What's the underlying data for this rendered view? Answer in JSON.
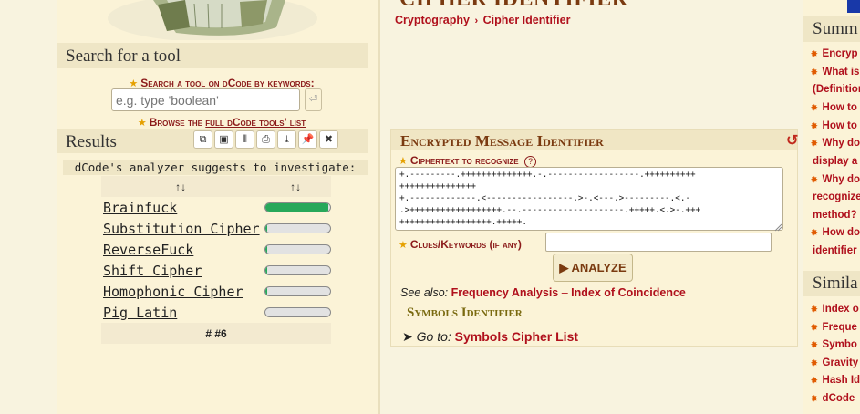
{
  "left": {
    "search_title": "Search for a tool",
    "search_label": "Search a tool on dCode by keywords:",
    "search_placeholder": "e.g. type 'boolean'",
    "browse_prefix": "Browse the ",
    "browse_link": "full dCode tools' list",
    "results_title": "Results",
    "analyzer_text": "dCode's analyzer suggests to investigate:",
    "sort_icon": "↑↓",
    "results": [
      {
        "name": "Brainfuck",
        "score": 0.97
      },
      {
        "name": "Substitution Cipher",
        "score": 0.03
      },
      {
        "name": "ReverseFuck",
        "score": 0.03
      },
      {
        "name": "Shift Cipher",
        "score": 0.03
      },
      {
        "name": "Homophonic Cipher",
        "score": 0.03
      },
      {
        "name": "Pig Latin",
        "score": 0.0
      }
    ],
    "footer": "# #6"
  },
  "header": {
    "page_title": "CIPHER IDENTIFIER",
    "breadcrumb_1": "Cryptography",
    "breadcrumb_sep": "›",
    "breadcrumb_2": "Cipher Identifier"
  },
  "panel": {
    "title": "Encrypted Message Identifier",
    "ciphertext_label": "Ciphertext to recognize",
    "ciphertext_value": "+.---------.++++++++++++++.-.------------------.++++++++++\n+++++++++++++++\n+.-------------.<-----------------.>-.<---.>---------.<.-\n.>++++++++++++++++++.--.--------------------.+++++.<.>-.+++\n++++++++++++++++++.+++++.",
    "clues_label": "Clues/Keywords (if any)",
    "clues_value": "",
    "analyze_label": "ANALYZE",
    "see_also_label": "See also:",
    "see_also_1": "Frequency Analysis",
    "see_also_sep": "–",
    "see_also_2": "Index of Coincidence",
    "symbols_title": "Symbols Identifier",
    "goto_label": "Go to:",
    "goto_link": "Symbols Cipher List"
  },
  "right": {
    "summary_title": "Summ",
    "summary_items": [
      "Encryp",
      "What is",
      "(Definition",
      "How to",
      "How to",
      "Why do",
      "display a",
      "Why do",
      "recognize",
      "method?",
      "How do",
      "identifier"
    ],
    "similar_title": "Simila",
    "similar_items": [
      "Index o",
      "Freque",
      "Symbo",
      "Gravity",
      "Hash Id",
      "dCode"
    ]
  },
  "colors": {
    "accent": "#b0101c",
    "bar": "#27a85a",
    "panel_bg": "#fbf3d7"
  }
}
